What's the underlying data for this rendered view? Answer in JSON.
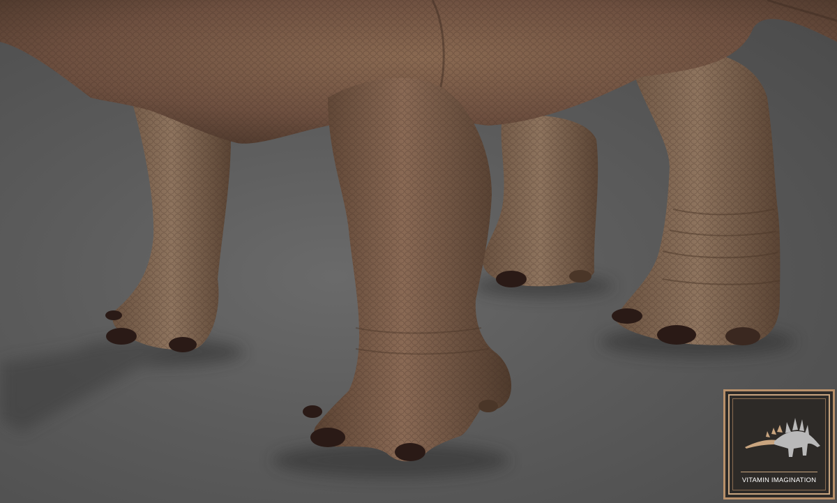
{
  "scene": {
    "subject": "dinosaur-legs-render",
    "colors": {
      "background": "#5a5a5a",
      "skin": "#7a5a45",
      "skin_dark": "#5a4232",
      "claw": "#2a1a16",
      "frame_gold": "#b8906a",
      "badge_bg": "#2d2a27"
    }
  },
  "watermark": {
    "text": "VITAMIN IMAGINATION",
    "icon": "stegosaurus-icon"
  }
}
